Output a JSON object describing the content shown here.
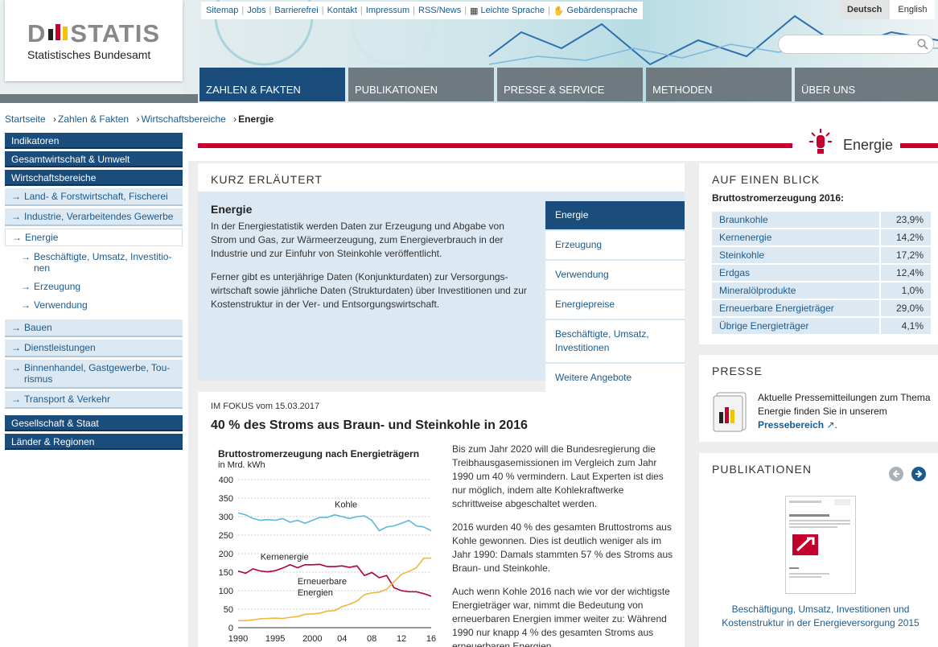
{
  "header": {
    "logo_word": "STATIS",
    "logo_d": "D",
    "logo_sub": "Statistisches Bundesamt",
    "utility_links": [
      "Sitemap",
      "Jobs",
      "Barrierefrei",
      "Kontakt",
      "Impressum",
      "RSS/News",
      "Leichte Sprache",
      "Gebärdensprache"
    ],
    "languages": [
      "Deutsch",
      "English"
    ],
    "search_placeholder": ""
  },
  "nav": [
    {
      "label": "ZAHLEN & FAKTEN",
      "active": true
    },
    {
      "label": "PUBLIKATIONEN"
    },
    {
      "label": "PRESSE & SERVICE"
    },
    {
      "label": "METHODEN"
    },
    {
      "label": "ÜBER UNS"
    }
  ],
  "breadcrumb": [
    "Startseite",
    "Zahlen & Fakten",
    "Wirtschaftsbereiche",
    "Energie"
  ],
  "sidebar": {
    "top1": [
      "Indikatoren",
      "Gesamtwirtschaft & Umwelt",
      "Wirtschaftsbereiche"
    ],
    "sub1": [
      "Land- & Forstwirtschaft, Fischerei",
      "Industrie, Verarbeitendes Gewerbe",
      "Energie"
    ],
    "sub3": [
      "Beschäftigte, Umsatz, Investitio-nen",
      "Erzeugung",
      "Verwendung"
    ],
    "sub2": [
      "Bauen",
      "Dienstleistungen",
      "Binnenhandel, Gastgewerbe, Tou-rismus",
      "Transport & Verkehr"
    ],
    "top2": [
      "Gesellschaft & Staat",
      "Länder & Regionen"
    ]
  },
  "page_title": "Energie",
  "kurz": {
    "heading": "KURZ ERLÄUTERT",
    "title": "Energie",
    "p1": "In der Energiestatistik werden Daten zur Erzeugung und Abgabe von Strom und Gas, zur Wärmeerzeugung, zum Energieverbrauch in der Industrie und zur Einfuhr von Steinkohle veröffentlicht.",
    "p2": "Ferner gibt es unterjährige Daten (Konjunkturdaten) zur Versorgungs-wirtschaft sowie jährliche Daten (Strukturdaten) über Investitionen und zur Kostenstruktur in der Ver- und Entsorgungswirtschaft.",
    "tabs": [
      "Energie",
      "Erzeugung",
      "Verwendung",
      "Energiepreise",
      "Beschäftigte, Umsatz, Investitionen",
      "Weitere Angebote"
    ]
  },
  "fokus": {
    "date": "IM FOKUS vom 15.03.2017",
    "title": "40 % des Stroms aus Braun- und Steinkohle in 2016",
    "chart_title": "Bruttostromerzeugung nach Energieträgern",
    "chart_unit": "in Mrd. kWh",
    "p1": "Bis zum Jahr 2020 will die Bundesregierung die Treibhausgasemissionen im Vergleich zum Jahr 1990 um 40 % vermindern. Laut Experten ist dies nur möglich, indem alte Kohlekraftwerke schrittweise abgeschaltet werden.",
    "p2": "2016 wurden 40 % des gesamten Bruttostroms aus Kohle gewonnen. Dies ist deutlich weniger als im Jahr 1990: Damals stammten 57 % des Stroms aus Braun- und Steinkohle.",
    "p3": "Auch wenn Kohle 2016 nach wie vor der wichtigste Energieträger war, nimmt die Bedeutung von erneuerbaren Energien immer weiter zu: Während 1990 nur knapp 4 % des gesamten Stroms aus erneuerbaren Energien"
  },
  "chart_data": {
    "type": "line",
    "title": "Bruttostromerzeugung nach Energieträgern",
    "ylabel": "in Mrd. kWh",
    "ylim": [
      0,
      400
    ],
    "yticks": [
      "400",
      "350",
      "300",
      "250",
      "200",
      "150",
      "100",
      "50",
      "0"
    ],
    "xticks": [
      "1990",
      "1995",
      "2000",
      "04",
      "08",
      "12",
      "16"
    ],
    "x": [
      1990,
      1991,
      1992,
      1993,
      1994,
      1995,
      1996,
      1997,
      1998,
      1999,
      2000,
      2001,
      2002,
      2003,
      2004,
      2005,
      2006,
      2007,
      2008,
      2009,
      2010,
      2011,
      2012,
      2013,
      2014,
      2015,
      2016
    ],
    "series": [
      {
        "name": "Kohle",
        "color": "#5bb8dd",
        "values": [
          310,
          305,
          295,
          290,
          292,
          290,
          295,
          285,
          290,
          282,
          290,
          298,
          298,
          305,
          300,
          295,
          300,
          302,
          290,
          262,
          272,
          275,
          282,
          290,
          275,
          272,
          262
        ]
      },
      {
        "name": "Kernenergie",
        "color": "#b0003a",
        "values": [
          153,
          147,
          159,
          153,
          151,
          154,
          161,
          170,
          162,
          170,
          170,
          171,
          165,
          165,
          167,
          163,
          167,
          141,
          149,
          135,
          141,
          108,
          100,
          97,
          97,
          92,
          85
        ]
      },
      {
        "name": "Erneuerbare Energien",
        "color": "#f2b63c",
        "values": [
          19,
          19,
          21,
          24,
          25,
          26,
          25,
          28,
          30,
          36,
          37,
          39,
          45,
          46,
          57,
          63,
          72,
          89,
          94,
          96,
          104,
          124,
          144,
          152,
          162,
          188,
          188
        ]
      }
    ]
  },
  "blick": {
    "heading": "AUF EINEN BLICK",
    "subtitle": "Bruttostromerzeugung 2016:",
    "rows": [
      {
        "label": "Braunkohle",
        "value": "23,9%"
      },
      {
        "label": "Kernenergie",
        "value": "14,2%"
      },
      {
        "label": "Steinkohle",
        "value": "17,2%"
      },
      {
        "label": "Erdgas",
        "value": "12,4%"
      },
      {
        "label": "Mineralölprodukte",
        "value": "1,0%"
      },
      {
        "label": "Erneuerbare Energieträger",
        "value": "29,0%"
      },
      {
        "label": "Übrige Energieträger",
        "value": "4,1%"
      }
    ]
  },
  "presse": {
    "heading": "PRESSE",
    "text": "Aktuelle Pressemitteilungen zum Thema Energie finden Sie in unserem",
    "link": "Pressebereich",
    "end": "."
  },
  "pub": {
    "heading": "PUBLIKATIONEN",
    "caption": "Beschäftigung, Umsatz, Investitionen und Kostenstruktur in der Energieversorgung 2015"
  }
}
